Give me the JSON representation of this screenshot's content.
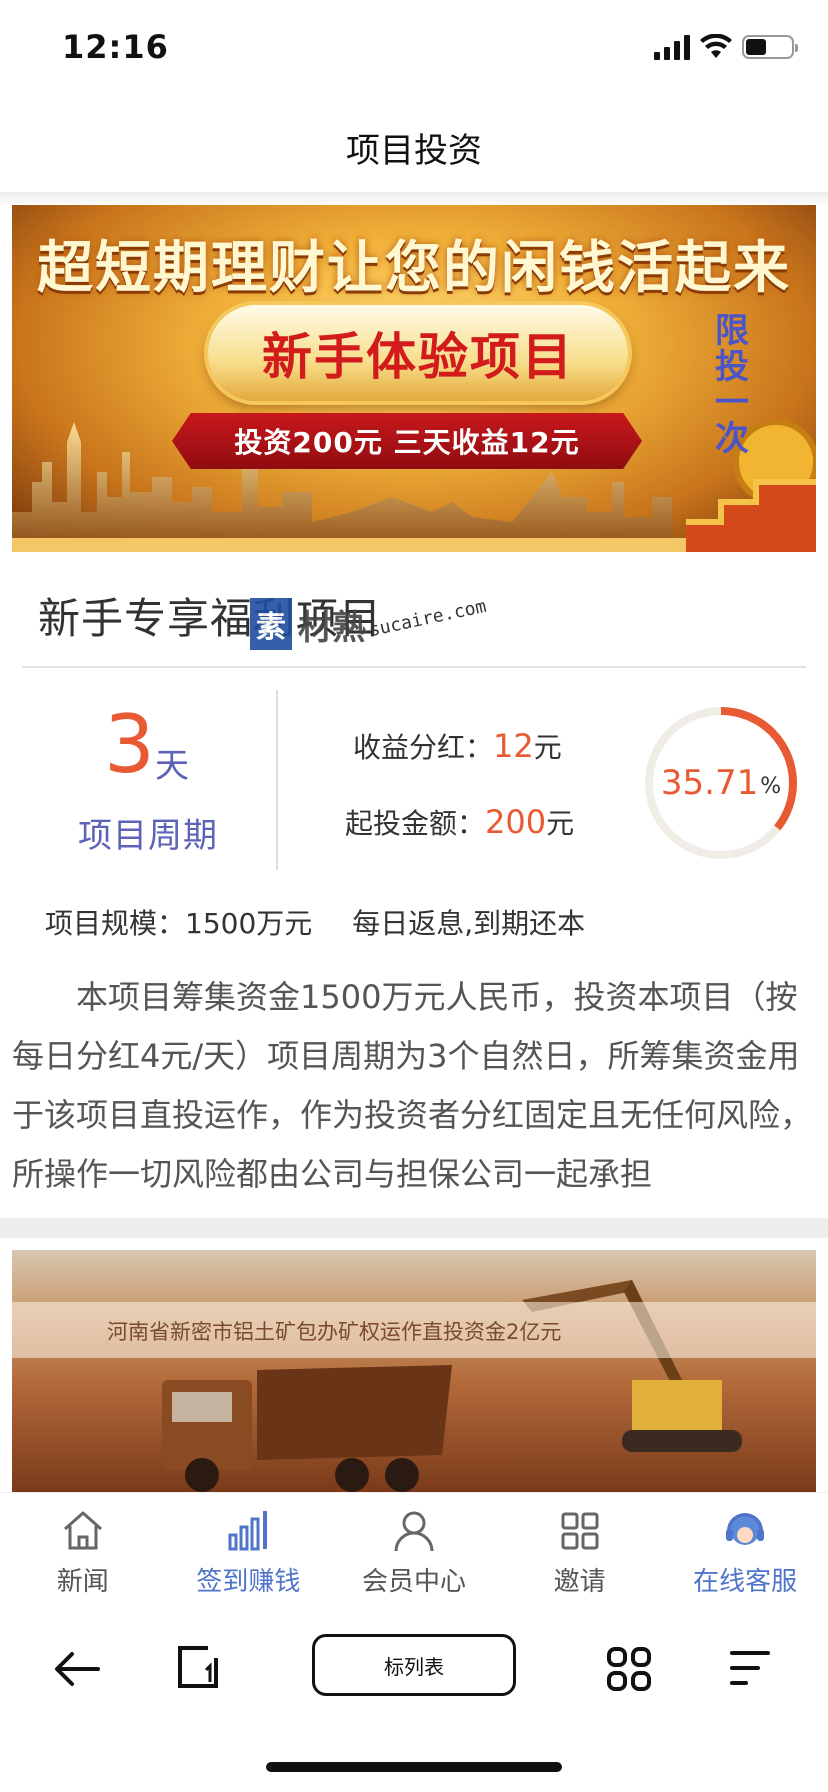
{
  "status_bar": {
    "time": "12:16"
  },
  "header": {
    "title": "项目投资"
  },
  "banner": {
    "headline": "超短期理财让您的闲钱活起来",
    "pill": "新手体验项目",
    "ribbon": "投资200元 三天收益12元",
    "vertical": [
      "限",
      "投",
      "一",
      "次"
    ]
  },
  "product": {
    "title": "新手专享福利项目",
    "watermark": {
      "box": "素",
      "text": "材熟",
      "url": "sucaire.com"
    },
    "period": {
      "number": "3",
      "unit": "天",
      "label": "项目周期"
    },
    "stats": [
      {
        "label": "收益分红：",
        "value": "12",
        "unit": "元"
      },
      {
        "label": "起投金额：",
        "value": "200",
        "unit": "元"
      }
    ],
    "progress": {
      "percent_text": "35.71",
      "symbol": "%",
      "fraction": 0.3571
    },
    "scale": "项目规模：1500万元",
    "repayment": "每日返息,到期还本",
    "description": "本项目筹集资金1500万元人民币，投资本项目（按每日分红4元/天）项目周期为3个自然日，所筹集资金用于该项目直投运作，作为投资者分红固定且无任何风险，所操作一切风险都由公司与担保公司一起承担"
  },
  "banner2": {
    "caption": "河南省新密市铝土矿包办矿权运作直投资金2亿元"
  },
  "tabbar": [
    {
      "label": "新闻",
      "icon": "home-icon",
      "active": false
    },
    {
      "label": "签到赚钱",
      "icon": "bar-chart-icon",
      "active": true
    },
    {
      "label": "会员中心",
      "icon": "user-icon",
      "active": false
    },
    {
      "label": "邀请",
      "icon": "grid-icon",
      "active": false
    },
    {
      "label": "在线客服",
      "icon": "headset-icon",
      "active": false
    }
  ],
  "browser": {
    "url_label": "标列表"
  },
  "colors": {
    "accent": "#e85a33",
    "primary": "#5b62b8",
    "tab_active": "#4f74c9"
  }
}
